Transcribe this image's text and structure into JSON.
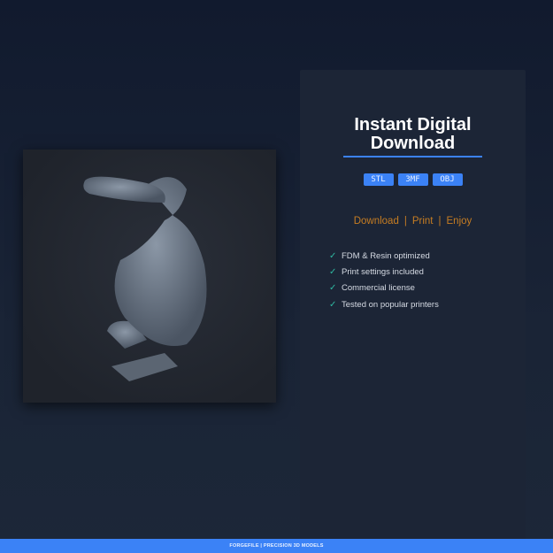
{
  "product": {
    "title_line1": "Instant Digital",
    "title_line2": "Download",
    "formats": [
      "STL",
      "3MF",
      "OBJ"
    ],
    "tagline": [
      "Download",
      "Print",
      "Enjoy"
    ],
    "separator": "|",
    "features": [
      "FDM & Resin optimized",
      "Print settings included",
      "Commercial license",
      "Tested on popular printers"
    ],
    "check_icon": "✓"
  },
  "footer": {
    "text": "FORGEFILE | PRECISION 3D MODELS"
  },
  "colors": {
    "accent": "#3b82f6",
    "tagline": "#c77d22",
    "check": "#2fb8a0"
  }
}
